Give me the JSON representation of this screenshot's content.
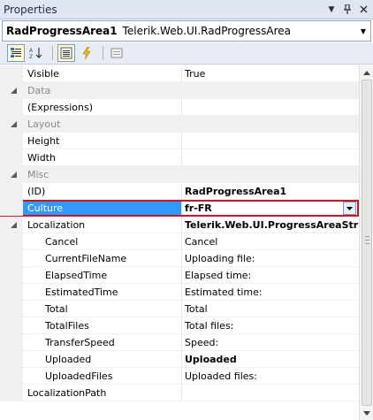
{
  "panel": {
    "title": "Properties"
  },
  "object_selector": {
    "name": "RadProgressArea1",
    "type": "Telerik.Web.UI.RadProgressArea"
  },
  "toolbar": {
    "buttons": [
      {
        "icon": "categorized-icon",
        "active": true
      },
      {
        "icon": "alphabetical-sort-icon",
        "active": false
      },
      {
        "icon": "properties-icon",
        "active": true
      },
      {
        "icon": "events-lightning-icon",
        "active": false
      },
      {
        "icon": "property-pages-icon",
        "active": false
      }
    ]
  },
  "rows": [
    {
      "kind": "prop",
      "name": "Visible",
      "value": "True"
    },
    {
      "kind": "cat",
      "name": "Data"
    },
    {
      "kind": "prop",
      "name": "(Expressions)",
      "value": ""
    },
    {
      "kind": "cat",
      "name": "Layout"
    },
    {
      "kind": "prop",
      "name": "Height",
      "value": ""
    },
    {
      "kind": "prop",
      "name": "Width",
      "value": ""
    },
    {
      "kind": "cat",
      "name": "Misc"
    },
    {
      "kind": "prop",
      "name": "(ID)",
      "value": "RadProgressArea1",
      "bold": true
    },
    {
      "kind": "prop",
      "name": "Culture",
      "value": "fr-FR",
      "bold": true,
      "selected": true
    },
    {
      "kind": "expandable",
      "name": "Localization",
      "value": "Telerik.Web.UI.ProgressAreaString",
      "bold": true
    },
    {
      "kind": "sub",
      "name": "Cancel",
      "value": "Cancel"
    },
    {
      "kind": "sub",
      "name": "CurrentFileName",
      "value": "Uploading file:"
    },
    {
      "kind": "sub",
      "name": "ElapsedTime",
      "value": "Elapsed time:"
    },
    {
      "kind": "sub",
      "name": "EstimatedTime",
      "value": "Estimated time:"
    },
    {
      "kind": "sub",
      "name": "Total",
      "value": "Total"
    },
    {
      "kind": "sub",
      "name": "TotalFiles",
      "value": "Total files:"
    },
    {
      "kind": "sub",
      "name": "TransferSpeed",
      "value": "Speed:"
    },
    {
      "kind": "sub",
      "name": "Uploaded",
      "value": "Uploaded",
      "bold": true
    },
    {
      "kind": "sub",
      "name": "UploadedFiles",
      "value": "Uploaded files:"
    },
    {
      "kind": "prop",
      "name": "LocalizationPath",
      "value": ""
    }
  ],
  "colors": {
    "selection": "#3399ff",
    "highlight_border": "#c0182a",
    "category_bg": "#f0f0f0"
  }
}
